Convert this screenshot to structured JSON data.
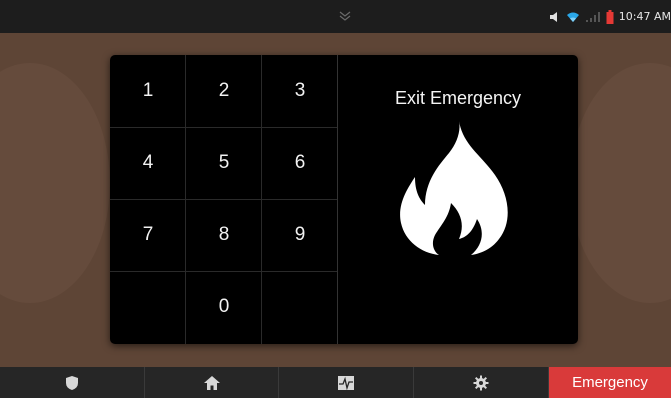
{
  "status_bar": {
    "time": "10:47 AM",
    "icons": [
      "pull-down-handle-icon",
      "volume-mute-icon",
      "wifi-icon",
      "cell-signal-icon",
      "battery-low-icon"
    ],
    "battery_color": "#e53935",
    "wifi_color": "#2aa7e8"
  },
  "keypad": {
    "keys": [
      "1",
      "2",
      "3",
      "4",
      "5",
      "6",
      "7",
      "8",
      "9",
      "0"
    ]
  },
  "exit_panel": {
    "title": "Exit Emergency",
    "icon": "fire-icon"
  },
  "nav": {
    "items": [
      {
        "icon": "shield-icon"
      },
      {
        "icon": "home-icon"
      },
      {
        "icon": "activity-monitor-icon"
      },
      {
        "icon": "gear-icon"
      },
      {
        "label": "Emergency"
      }
    ],
    "emergency_color": "#d93a3a"
  }
}
